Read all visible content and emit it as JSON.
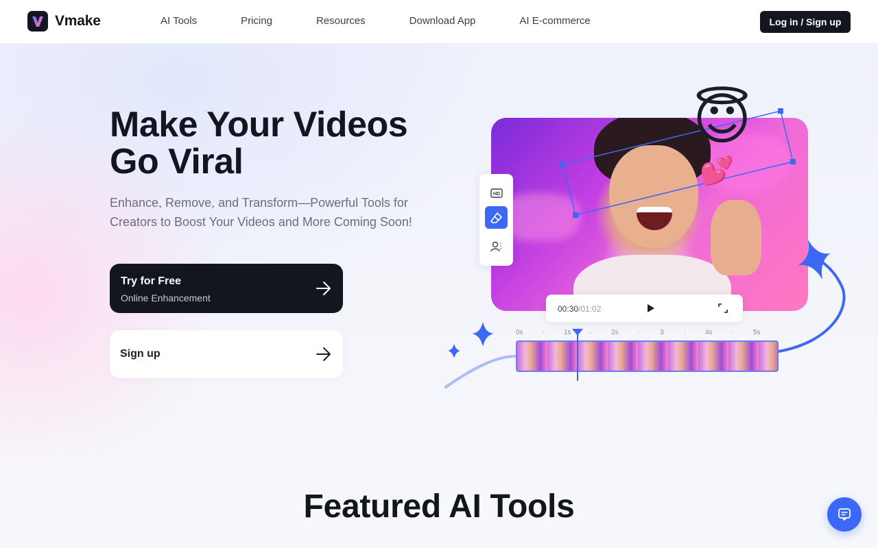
{
  "header": {
    "brand": "Vmake",
    "nav": [
      "AI Tools",
      "Pricing",
      "Resources",
      "Download App",
      "AI E-commerce"
    ],
    "login_label": "Log in / Sign up"
  },
  "hero": {
    "title_line1": "Make Your Videos",
    "title_line2": "Go Viral",
    "subtitle": "Enhance, Remove, and Transform—Powerful Tools for Creators to Boost Your Videos and More Coming Soon!",
    "primary_cta": {
      "label": "Try for Free",
      "sublabel": "Online Enhancement"
    },
    "secondary_cta": {
      "label": "Sign up"
    }
  },
  "preview": {
    "tools": [
      {
        "icon": "hd-icon",
        "active": false
      },
      {
        "icon": "eraser-icon",
        "active": true
      },
      {
        "icon": "person-remove-icon",
        "active": false
      }
    ],
    "player": {
      "current_time": "00:30",
      "separator": "/",
      "total_time": "01:02"
    },
    "ruler": [
      "0s",
      "·",
      "1s",
      "·",
      "2s",
      "·",
      "3",
      "·",
      "4s",
      "·",
      "5s"
    ],
    "emoji": "😇",
    "hearts": "💕"
  },
  "featured": {
    "title": "Featured AI Tools"
  },
  "colors": {
    "accent": "#3b68f5",
    "dark": "#14161f",
    "text_muted": "#6a6d7a"
  }
}
